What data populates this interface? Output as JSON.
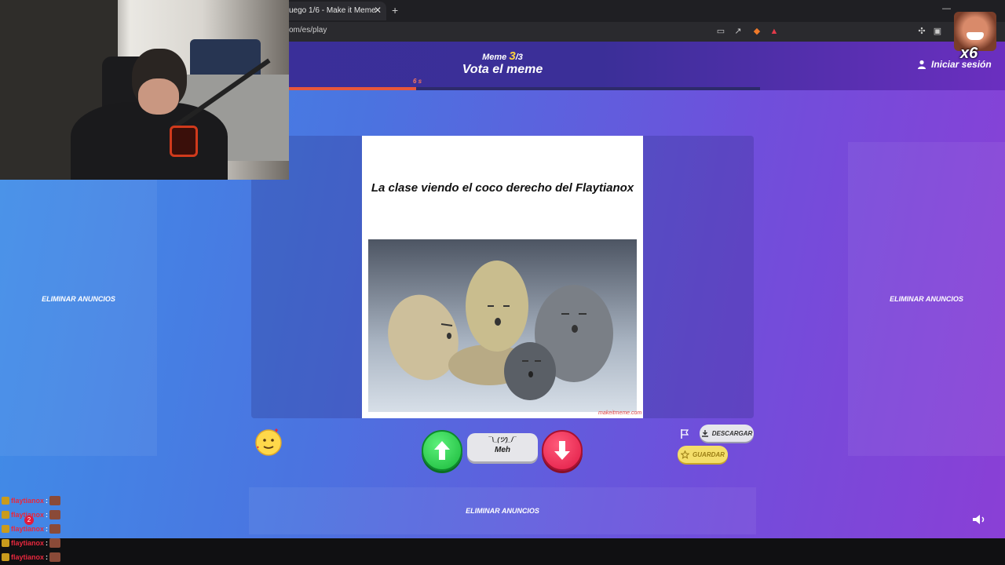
{
  "browser": {
    "tab_title": "uego 1/6 - Make it Meme",
    "tab_close": "✕",
    "new_tab": "+",
    "url": "om/es/play",
    "window_controls": [
      "—",
      "□",
      "✕"
    ]
  },
  "header": {
    "meme_prefix": "Meme",
    "meme_current": "3",
    "meme_total": "/3",
    "title": "Vota el meme",
    "login_label": "Iniciar sesión",
    "timer": "6 s",
    "timer_progress": 0.27
  },
  "ads": {
    "left": "ELIMINAR ANUNCIOS",
    "right": "ELIMINAR ANUNCIOS",
    "bottom": "ELIMINAR ANUNCIOS"
  },
  "meme": {
    "caption": "La clase viendo el coco derecho del Flaytianox",
    "image": "moai-stones-image",
    "watermark": "makeitmeme.com"
  },
  "actions": {
    "meh_face": "¯\\_(ツ)_/¯",
    "meh_label": "Meh",
    "download_label": "DESCARGAR",
    "save_label": "GUARDAR"
  },
  "overlays": {
    "reaction_label": "x6",
    "chat": [
      {
        "user": "flaytianox",
        "sep": ":"
      },
      {
        "user": "flaytianox",
        "sep": ":"
      },
      {
        "user": "flaytianox",
        "sep": ":"
      },
      {
        "user": "flaytianox",
        "sep": ":"
      },
      {
        "user": "flaytianox",
        "sep": ":"
      }
    ],
    "notification_count": "2"
  },
  "colors": {
    "accent_yellow": "#ffd23c",
    "timer_red": "#e8573b",
    "vote_up": "#19b83a",
    "vote_down": "#e01a45"
  }
}
